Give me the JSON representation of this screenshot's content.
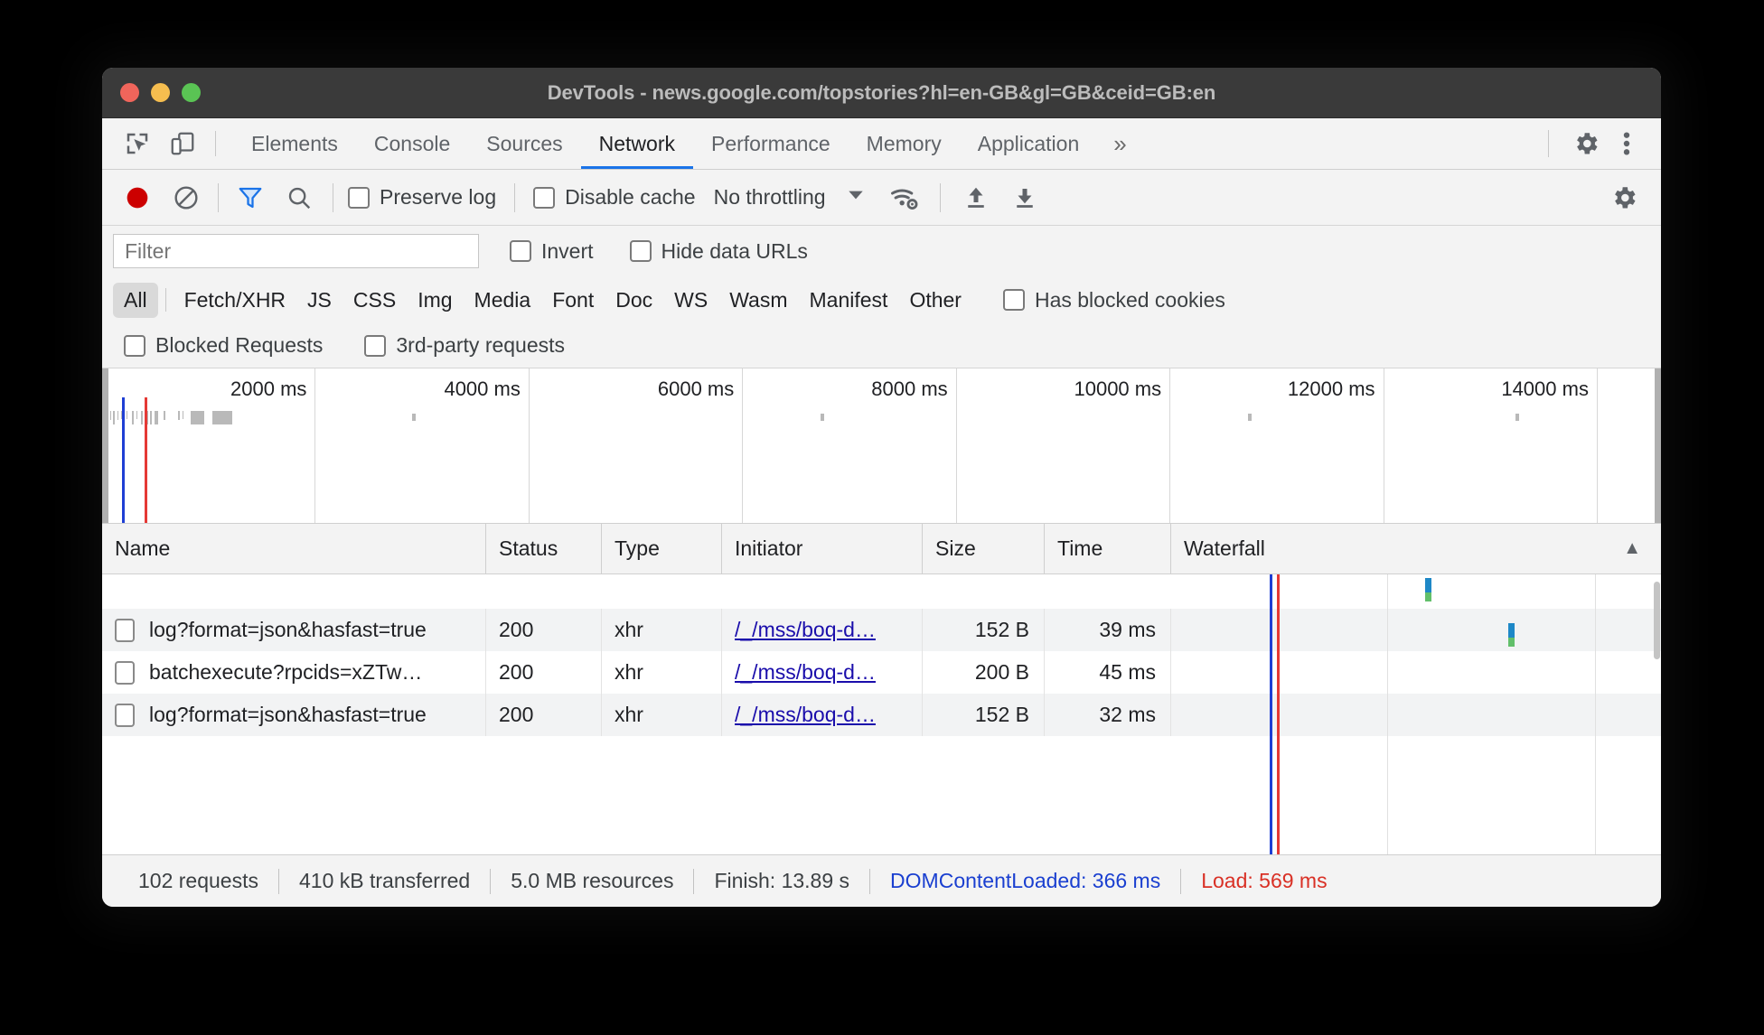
{
  "window": {
    "title": "DevTools - news.google.com/topstories?hl=en-GB&gl=GB&ceid=GB:en",
    "traffic_lights": [
      "close",
      "minimize",
      "zoom"
    ]
  },
  "tabbar": {
    "icons": [
      {
        "name": "inspect-element-icon",
        "label": "Inspect"
      },
      {
        "name": "device-toolbar-icon",
        "label": "Toggle device toolbar"
      }
    ],
    "tabs": [
      {
        "label": "Elements",
        "active": false
      },
      {
        "label": "Console",
        "active": false
      },
      {
        "label": "Sources",
        "active": false
      },
      {
        "label": "Network",
        "active": true
      },
      {
        "label": "Performance",
        "active": false
      },
      {
        "label": "Memory",
        "active": false
      },
      {
        "label": "Application",
        "active": false
      }
    ],
    "more_label": "»",
    "settings_icon": "gear-icon",
    "menu_icon": "kebab-menu-icon"
  },
  "network_toolbar": {
    "record_label": "Stop recording network log",
    "clear_label": "Clear",
    "filter_toggle_label": "Filter",
    "search_label": "Search",
    "preserve_log": {
      "label": "Preserve log",
      "checked": false
    },
    "disable_cache": {
      "label": "Disable cache",
      "checked": false
    },
    "throttling": {
      "value": "No throttling",
      "caret": "▼"
    },
    "wifi_label": "Network conditions",
    "import_label": "Import HAR file",
    "export_label": "Export HAR file",
    "settings_label": "Network settings"
  },
  "filter_row": {
    "filter_placeholder": "Filter",
    "filter_value": "",
    "invert": {
      "label": "Invert",
      "checked": false
    },
    "hide_data_urls": {
      "label": "Hide data URLs",
      "checked": false
    }
  },
  "type_filters": {
    "chips": [
      {
        "label": "All",
        "selected": true
      },
      {
        "label": "Fetch/XHR",
        "selected": false
      },
      {
        "label": "JS",
        "selected": false
      },
      {
        "label": "CSS",
        "selected": false
      },
      {
        "label": "Img",
        "selected": false
      },
      {
        "label": "Media",
        "selected": false
      },
      {
        "label": "Font",
        "selected": false
      },
      {
        "label": "Doc",
        "selected": false
      },
      {
        "label": "WS",
        "selected": false
      },
      {
        "label": "Wasm",
        "selected": false
      },
      {
        "label": "Manifest",
        "selected": false
      },
      {
        "label": "Other",
        "selected": false
      }
    ],
    "has_blocked_cookies": {
      "label": "Has blocked cookies",
      "checked": false
    },
    "blocked_requests": {
      "label": "Blocked Requests",
      "checked": false
    },
    "third_party_requests": {
      "label": "3rd-party requests",
      "checked": false
    }
  },
  "overview": {
    "ticks": [
      "2000 ms",
      "4000 ms",
      "6000 ms",
      "8000 ms",
      "10000 ms",
      "12000 ms",
      "14000 ms"
    ],
    "dcl_marker_color": "#1f3fd4",
    "load_marker_color": "#e53935"
  },
  "table": {
    "columns": [
      "Name",
      "Status",
      "Type",
      "Initiator",
      "Size",
      "Time",
      "Waterfall"
    ],
    "sort_indicator": "▲",
    "rows": [
      {
        "name": "log?format=json&hasfast=true",
        "status": "200",
        "type": "xhr",
        "initiator": "/_/mss/boq-d…",
        "size": "152 B",
        "time": "39 ms"
      },
      {
        "name": "batchexecute?rpcids=xZTw…",
        "status": "200",
        "type": "xhr",
        "initiator": "/_/mss/boq-d…",
        "size": "200 B",
        "time": "45 ms"
      },
      {
        "name": "log?format=json&hasfast=true",
        "status": "200",
        "type": "xhr",
        "initiator": "/_/mss/boq-d…",
        "size": "152 B",
        "time": "32 ms"
      }
    ]
  },
  "status_bar": {
    "requests": "102 requests",
    "transferred": "410 kB transferred",
    "resources": "5.0 MB resources",
    "finish": "Finish: 13.89 s",
    "dom_content_loaded": "DOMContentLoaded: 366 ms",
    "load": "Load: 569 ms"
  },
  "colors": {
    "accent_blue": "#1a73e8",
    "dcl_blue": "#1a3fd0",
    "load_red": "#d93025",
    "link_blue": "#1a0dab",
    "record_red": "#cc0000"
  }
}
